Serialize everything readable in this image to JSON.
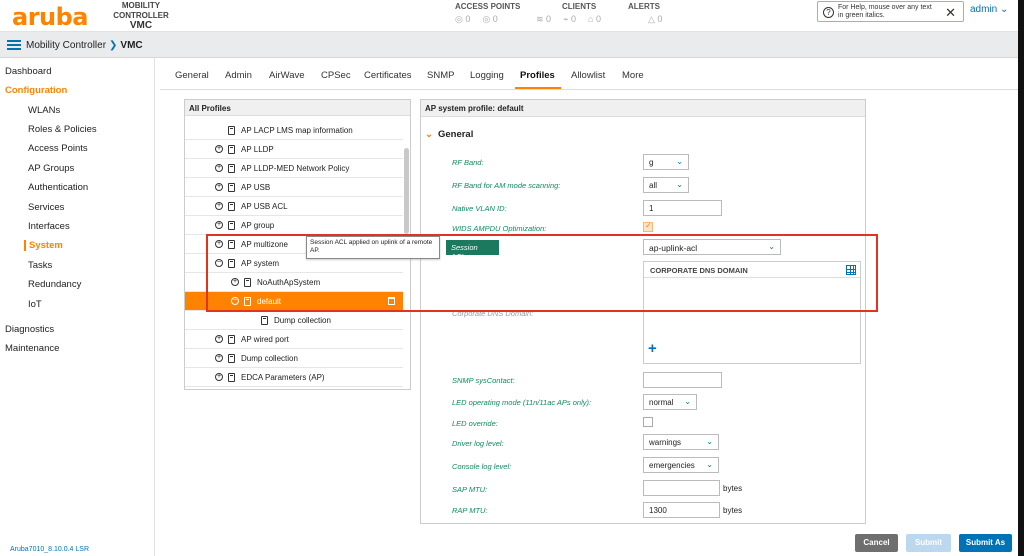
{
  "header": {
    "logo": "aruba",
    "product": "MOBILITY CONTROLLER",
    "device": "VMC",
    "access_points": {
      "label": "ACCESS POINTS",
      "values": [
        "0",
        "0"
      ]
    },
    "clients": {
      "label": "CLIENTS",
      "values": [
        "0",
        "0",
        "0"
      ]
    },
    "alerts": {
      "label": "ALERTS",
      "values": [
        "0"
      ]
    },
    "help_text": "For Help, mouse over any text in green italics.",
    "user": "admin ⌄"
  },
  "breadcrumb": {
    "root": "Mobility Controller",
    "current": "VMC"
  },
  "nav": {
    "dashboard": "Dashboard",
    "configuration": "Configuration",
    "items": [
      "WLANs",
      "Roles & Policies",
      "Access Points",
      "AP Groups",
      "Authentication",
      "Services",
      "Interfaces",
      "System",
      "Tasks",
      "Redundancy",
      "IoT"
    ],
    "diagnostics": "Diagnostics",
    "maintenance": "Maintenance",
    "version": "Aruba7010_8.10.0.4 LSR"
  },
  "tabs": [
    "General",
    "Admin",
    "AirWave",
    "CPSec",
    "Certificates",
    "SNMP",
    "Logging",
    "Profiles",
    "Allowlist",
    "More"
  ],
  "profiles": {
    "title": "All Profiles",
    "rows": [
      {
        "label": "AP LACP LMS map information",
        "toggle": ""
      },
      {
        "label": "AP LLDP",
        "toggle": "+"
      },
      {
        "label": "AP LLDP-MED Network Policy",
        "toggle": "+"
      },
      {
        "label": "AP USB",
        "toggle": "+"
      },
      {
        "label": "AP USB ACL",
        "toggle": "+"
      },
      {
        "label": "AP group",
        "toggle": "+"
      },
      {
        "label": "AP multizone",
        "toggle": "+"
      },
      {
        "label": "AP system",
        "toggle": "−"
      },
      {
        "label": "NoAuthApSystem",
        "toggle": "+"
      },
      {
        "label": "default",
        "toggle": "−"
      },
      {
        "label": "Dump collection",
        "toggle": ""
      },
      {
        "label": "AP wired port",
        "toggle": "+"
      },
      {
        "label": "Dump collection",
        "toggle": "+"
      },
      {
        "label": "EDCA Parameters (AP)",
        "toggle": "+"
      }
    ]
  },
  "system_profile": {
    "title": "AP system profile: default",
    "section": "General",
    "rf_band_label": "RF Band:",
    "rf_band_value": "g",
    "rf_band_am_label": "RF Band for AM mode scanning:",
    "rf_band_am_value": "all",
    "native_vlan_label": "Native VLAN ID:",
    "native_vlan_value": "1",
    "wids_label": "WIDS AMPDU Optimization:",
    "session_acl_label": "Session ACL:",
    "session_acl_value": "ap-uplink-acl",
    "dns_header": "CORPORATE DNS DOMAIN",
    "dns_plus": "+",
    "dns_label_ghost": "Corporate DNS Domain:",
    "snmp_label": "SNMP sysContact:",
    "led_mode_label": "LED operating mode (11n/11ac APs only):",
    "led_mode_value": "normal",
    "led_override_label": "LED override:",
    "driver_log_label": "Driver log level:",
    "driver_log_value": "warnings",
    "console_log_label": "Console log level:",
    "console_log_value": "emergencies",
    "sap_mtu_label": "SAP MTU:",
    "sap_mtu_unit": "bytes",
    "rap_mtu_label": "RAP MTU:",
    "rap_mtu_value": "1300",
    "rap_mtu_unit": "bytes"
  },
  "tooltip": "Session ACL applied on uplink of a remote AP.",
  "buttons": {
    "cancel": "Cancel",
    "submit": "Submit",
    "submit_as": "Submit As"
  },
  "colors": {
    "brand": "#ff8300",
    "link": "#0073b7",
    "help_green": "#0e8a61",
    "highlight_red": "#e0341e"
  }
}
